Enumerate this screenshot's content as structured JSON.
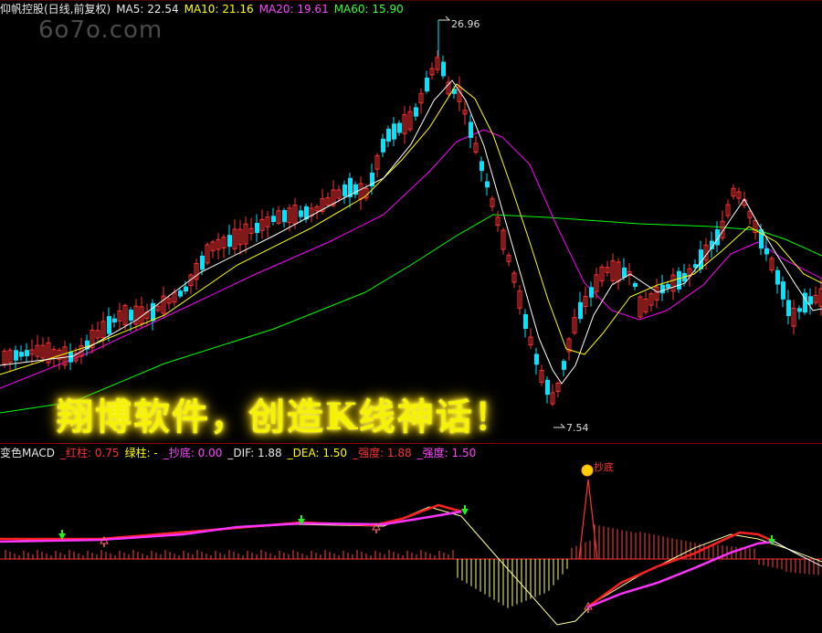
{
  "main_header": {
    "title": "仰帆控股(日线,前复权)",
    "ma5": "MA5: 22.54",
    "ma10": "MA10: 21.16",
    "ma20": "MA20: 19.61",
    "ma60": "MA60: 15.90"
  },
  "watermark": "6o7o.com",
  "slogan": "翔博软件，创造K线神话！",
  "price_marks": {
    "high": "26.96",
    "low": "7.54"
  },
  "sub_header": {
    "indicator": "变色MACD",
    "red_bar": "_红柱: 0.75",
    "green_bar": "绿柱: -",
    "bottom": "_抄底: 0.00",
    "dif": "_DIF: 1.88",
    "dea": "_DEA: 1.50",
    "strong1": "_强度: 1.88",
    "strong2": "_强度: 1.50"
  },
  "signal_label": "抄底",
  "colors": {
    "up": "#ff3232",
    "down": "#00e5ff",
    "ma5": "#ffffff",
    "ma10": "#ffff00",
    "ma20": "#ff00ff",
    "ma60": "#00ff00",
    "ma_mid": "#ffffff"
  },
  "chart_data": {
    "type": "candlestick",
    "price_axis": {
      "low": 7.54,
      "high": 26.96
    },
    "macd_label": "变色MACD"
  }
}
